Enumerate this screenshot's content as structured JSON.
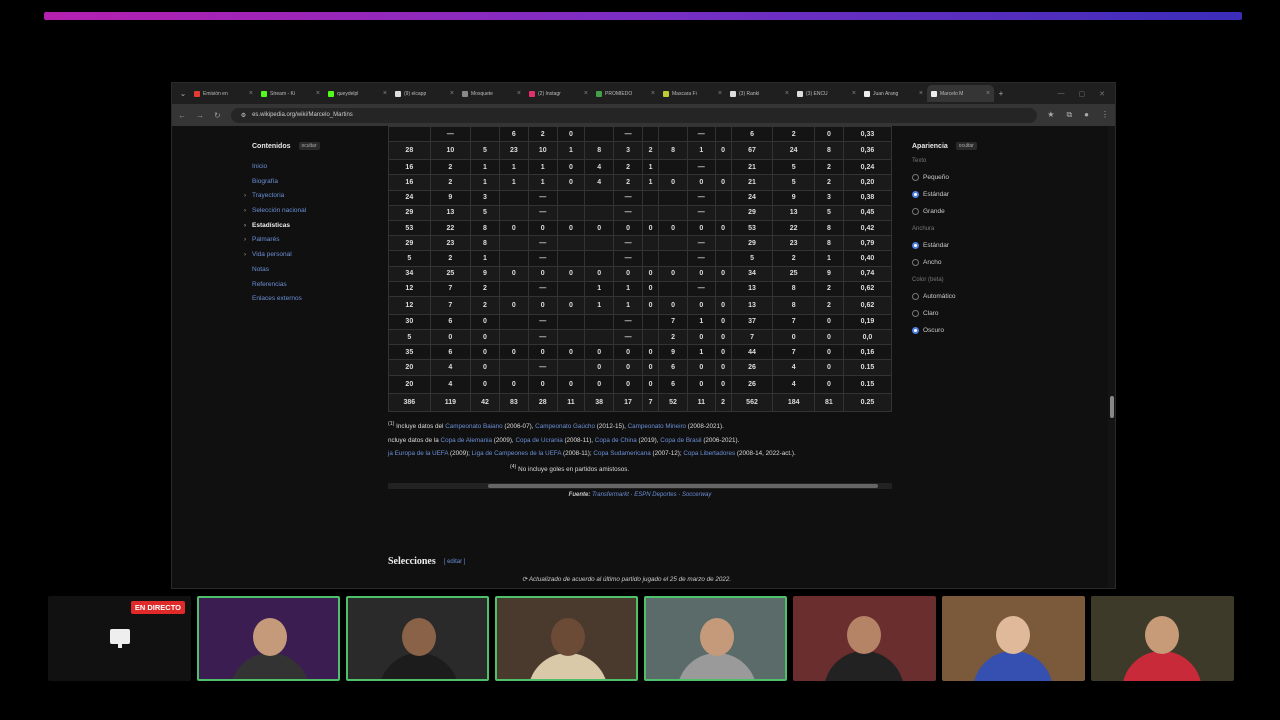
{
  "browser": {
    "tabs": [
      {
        "label": "Emisión en",
        "color": "#e53935"
      },
      {
        "label": "Stream - Ki",
        "color": "#53fc18"
      },
      {
        "label": "queydelpl",
        "color": "#53fc18"
      },
      {
        "label": "(9) elcapp",
        "color": "#dddddd"
      },
      {
        "label": "Mosquete",
        "color": "#888888"
      },
      {
        "label": "(2) Instagr",
        "color": "#e1306c"
      },
      {
        "label": "PROMIEDO",
        "color": "#43a047"
      },
      {
        "label": "Mascara Fi",
        "color": "#c0ca33"
      },
      {
        "label": "(3) Ranki",
        "color": "#dddddd"
      },
      {
        "label": "(3) ENCU",
        "color": "#dddddd"
      },
      {
        "label": "Juan Arang",
        "color": "#eeeeee"
      },
      {
        "label": "Marcelo M",
        "color": "#eeeeee"
      }
    ],
    "url": "es.wikipedia.org/wiki/Marcelo_Martins"
  },
  "toc": {
    "title": "Contenidos",
    "hide": "ocultar",
    "items": [
      {
        "label": "Inicio",
        "chev": ""
      },
      {
        "label": "Biografía",
        "chev": ""
      },
      {
        "label": "Trayectoria",
        "chev": "›"
      },
      {
        "label": "Selección nacional",
        "chev": "›"
      },
      {
        "label": "Estadísticas",
        "chev": "›"
      },
      {
        "label": "Palmarés",
        "chev": "›"
      },
      {
        "label": "Vida personal",
        "chev": "›"
      },
      {
        "label": "Notas",
        "chev": ""
      },
      {
        "label": "Referencias",
        "chev": ""
      },
      {
        "label": "Enlaces externos",
        "chev": ""
      }
    ]
  },
  "table": {
    "rows": [
      [
        "",
        "—",
        "",
        "6",
        "2",
        "0",
        "",
        "—",
        "",
        "",
        "—",
        "",
        "6",
        "2",
        "0",
        "0,33"
      ],
      [
        "28",
        "10",
        "5",
        "23",
        "10",
        "1",
        "8",
        "3",
        "2",
        "8",
        "1",
        "0",
        "67",
        "24",
        "8",
        "0,36"
      ],
      [
        "16",
        "2",
        "1",
        "1",
        "1",
        "0",
        "4",
        "2",
        "1",
        "",
        "—",
        "",
        "21",
        "5",
        "2",
        "0,24"
      ],
      [
        "16",
        "2",
        "1",
        "1",
        "1",
        "0",
        "4",
        "2",
        "1",
        "0",
        "0",
        "0",
        "21",
        "5",
        "2",
        "0,20"
      ],
      [
        "24",
        "9",
        "3",
        "",
        "—",
        "",
        "",
        "—",
        "",
        "",
        "—",
        "",
        "24",
        "9",
        "3",
        "0,38"
      ],
      [
        "29",
        "13",
        "5",
        "",
        "—",
        "",
        "",
        "—",
        "",
        "",
        "—",
        "",
        "29",
        "13",
        "5",
        "0,45"
      ],
      [
        "53",
        "22",
        "8",
        "0",
        "0",
        "0",
        "0",
        "0",
        "0",
        "0",
        "0",
        "0",
        "53",
        "22",
        "8",
        "0,42"
      ],
      [
        "29",
        "23",
        "8",
        "",
        "—",
        "",
        "",
        "—",
        "",
        "",
        "—",
        "",
        "29",
        "23",
        "8",
        "0,79"
      ],
      [
        "5",
        "2",
        "1",
        "",
        "—",
        "",
        "",
        "—",
        "",
        "",
        "—",
        "",
        "5",
        "2",
        "1",
        "0,40"
      ],
      [
        "34",
        "25",
        "9",
        "0",
        "0",
        "0",
        "0",
        "0",
        "0",
        "0",
        "0",
        "0",
        "34",
        "25",
        "9",
        "0,74"
      ],
      [
        "12",
        "7",
        "2",
        "",
        "—",
        "",
        "1",
        "1",
        "0",
        "",
        "—",
        "",
        "13",
        "8",
        "2",
        "0,62"
      ],
      [
        "12",
        "7",
        "2",
        "0",
        "0",
        "0",
        "1",
        "1",
        "0",
        "0",
        "0",
        "0",
        "13",
        "8",
        "2",
        "0,62"
      ],
      [
        "30",
        "6",
        "0",
        "",
        "—",
        "",
        "",
        "—",
        "",
        "7",
        "1",
        "0",
        "37",
        "7",
        "0",
        "0,19"
      ],
      [
        "5",
        "0",
        "0",
        "",
        "—",
        "",
        "",
        "—",
        "",
        "2",
        "0",
        "0",
        "7",
        "0",
        "0",
        "0,0"
      ],
      [
        "35",
        "6",
        "0",
        "0",
        "0",
        "0",
        "0",
        "0",
        "0",
        "9",
        "1",
        "0",
        "44",
        "7",
        "0",
        "0,16"
      ],
      [
        "20",
        "4",
        "0",
        "",
        "—",
        "",
        "0",
        "0",
        "0",
        "6",
        "0",
        "0",
        "26",
        "4",
        "0",
        "0.15"
      ],
      [
        "20",
        "4",
        "0",
        "0",
        "0",
        "0",
        "0",
        "0",
        "0",
        "6",
        "0",
        "0",
        "26",
        "4",
        "0",
        "0.15"
      ],
      [
        "386",
        "119",
        "42",
        "83",
        "28",
        "11",
        "38",
        "17",
        "7",
        "52",
        "11",
        "2",
        "562",
        "184",
        "81",
        "0.25"
      ]
    ]
  },
  "notes": {
    "n1_sup": "(1)",
    "n1_pre": " Incluye datos del ",
    "n1_l1": "Campeonato Baiano",
    "n1_t1": " (2006-07), ",
    "n1_l2": "Campeonato Gaúcho",
    "n1_t2": " (2012-15), ",
    "n1_l3": "Campeonato Mineiro",
    "n1_t3": " (2008-2021).",
    "n2_pre": "ncluye datos de la ",
    "n2_l1": "Copa de Alemania",
    "n2_t1": " (2009), ",
    "n2_l2": "Copa de Ucrania",
    "n2_t2": " (2008-11), ",
    "n2_l3": "Copa de China",
    "n2_t3": " (2019), ",
    "n2_l4": "Copa de Brasil",
    "n2_t4": " (2006-2021).",
    "n3_l1": "ja Europa de la UEFA",
    "n3_t1": " (2009); ",
    "n3_l2": "Liga de Campeones de la UEFA",
    "n3_t2": " (2008-11); ",
    "n3_l3": "Copa Sudamericana",
    "n3_t3": " (2007-12); ",
    "n3_l4": "Copa Libertadores",
    "n3_t4": " (2008-14, 2022-act.).",
    "n4_sup": "(4)",
    "n4": " No incluye goles en partidos amistosos."
  },
  "source": {
    "label": "Fuente:",
    "s1": "Transfermarkt",
    "sep1": " · ",
    "s2": "ESPN Deportes",
    "sep2": " · ",
    "s3": "Soccerway"
  },
  "section": {
    "heading": "Selecciones",
    "edit": "[ editar ]"
  },
  "updated": "Actualizado de acuerdo al último partido jugado el 25 de marzo de 2022.",
  "appearance": {
    "title": "Apariencia",
    "hide": "ocultar",
    "text_label": "Texto",
    "text_options": [
      {
        "label": "Pequeño",
        "on": false
      },
      {
        "label": "Estándar",
        "on": true
      },
      {
        "label": "Grande",
        "on": false
      }
    ],
    "width_label": "Anchura",
    "width_options": [
      {
        "label": "Estándar",
        "on": true
      },
      {
        "label": "Ancho",
        "on": false
      }
    ],
    "color_label": "Color (beta)",
    "color_options": [
      {
        "label": "Automático",
        "on": false
      },
      {
        "label": "Claro",
        "on": false
      },
      {
        "label": "Oscuro",
        "on": true
      }
    ]
  },
  "stream": {
    "live_badge": "EN DIRECTO",
    "cams": [
      {
        "bg": "#3c1d52",
        "skin": "#c49a7a",
        "shirt": "#333333"
      },
      {
        "bg": "#2a2a2a",
        "skin": "#8a6248",
        "shirt": "#1c1c1c"
      },
      {
        "bg": "#4a3a2e",
        "skin": "#6b4a36",
        "shirt": "#d9c9a8"
      },
      {
        "bg": "#5b6b6a",
        "skin": "#c49a7a",
        "shirt": "#9a9a9a"
      },
      {
        "bg": "#6b2e2e",
        "skin": "#b58466",
        "shirt": "#222222"
      },
      {
        "bg": "#7a5a3a",
        "skin": "#e0b89a",
        "shirt": "#3550b0"
      },
      {
        "bg": "#3d3a2a",
        "skin": "#c79a78",
        "shirt": "#c82a3a"
      }
    ]
  }
}
